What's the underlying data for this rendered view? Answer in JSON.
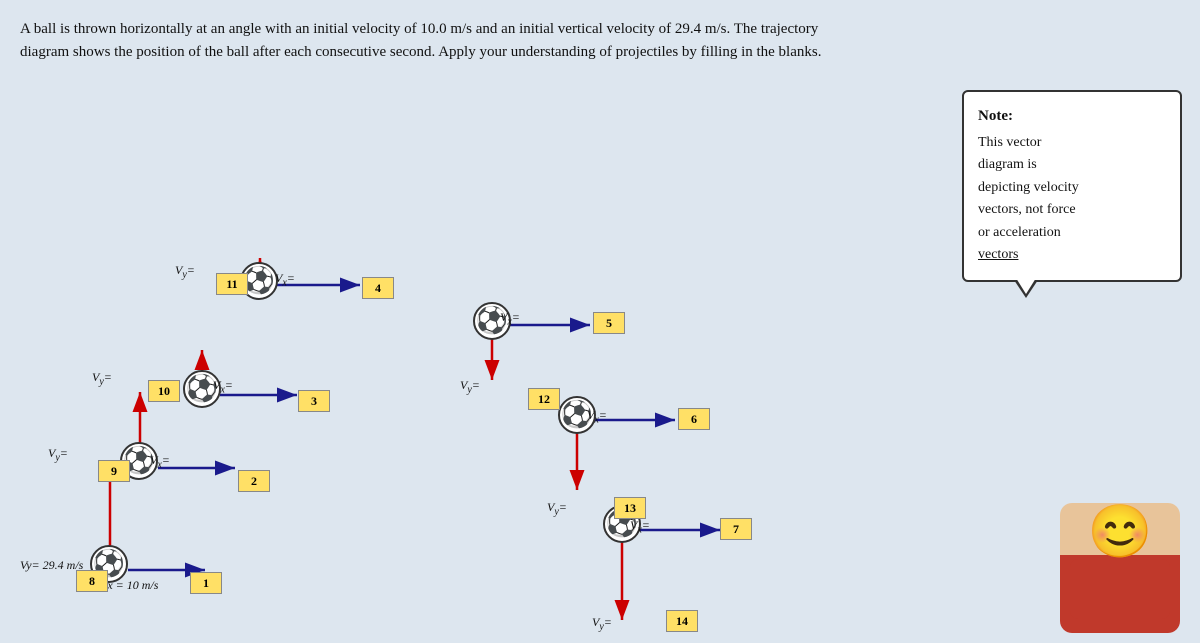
{
  "intro": {
    "text": "A ball is thrown horizontally at an angle with an initial velocity of 10.0 m/s and an initial vertical velocity of 29.4 m/s. The trajectory diagram shows the position of the ball after each consecutive second. Apply your understanding of projectiles by filling in the blanks."
  },
  "note": {
    "title": "Note:",
    "line1": "This vector",
    "line2": "diagram is",
    "line3": "depicting velocity",
    "line4": "vectors, not force",
    "line5": "or acceleration",
    "line6": "vectors"
  },
  "blanks": [
    1,
    2,
    3,
    4,
    5,
    6,
    7,
    8,
    9,
    10,
    11,
    12,
    13,
    14
  ],
  "labels": {
    "vx_initial": "Vx = 10 m/s",
    "vy_initial": "Vy= 29.4 m/s"
  }
}
